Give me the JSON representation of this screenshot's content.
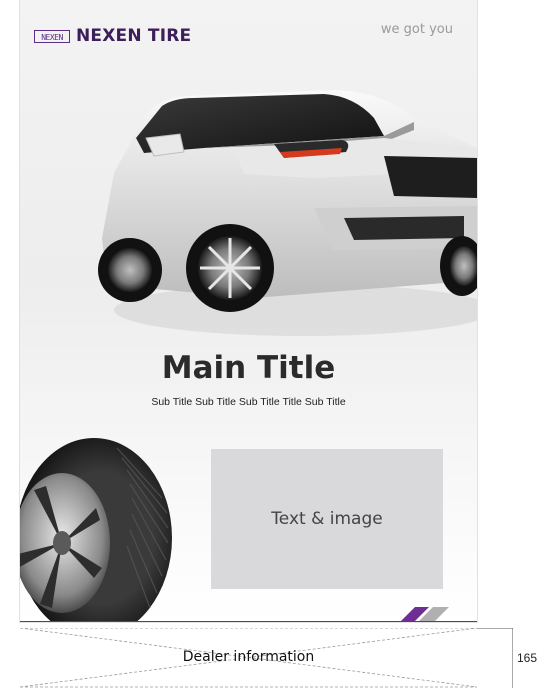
{
  "brand": {
    "logo_mark": "NEXEN",
    "name": "NEXEN TIRE",
    "tagline": "we got you"
  },
  "hero": {
    "title": "Main Title",
    "subtitle": "Sub Title Sub Title Sub Title Title Sub Title"
  },
  "content_box": {
    "label": "Text & image"
  },
  "dealer": {
    "label": "Dealer information",
    "height_marker": "165"
  },
  "colors": {
    "brand_purple": "#6d2f91",
    "stripe_gray": "#b0b0b0",
    "box_gray": "#d9d9db"
  },
  "icons": [
    "nexen-logo-icon",
    "car-image",
    "tire-image",
    "stripe-accent-icon"
  ]
}
